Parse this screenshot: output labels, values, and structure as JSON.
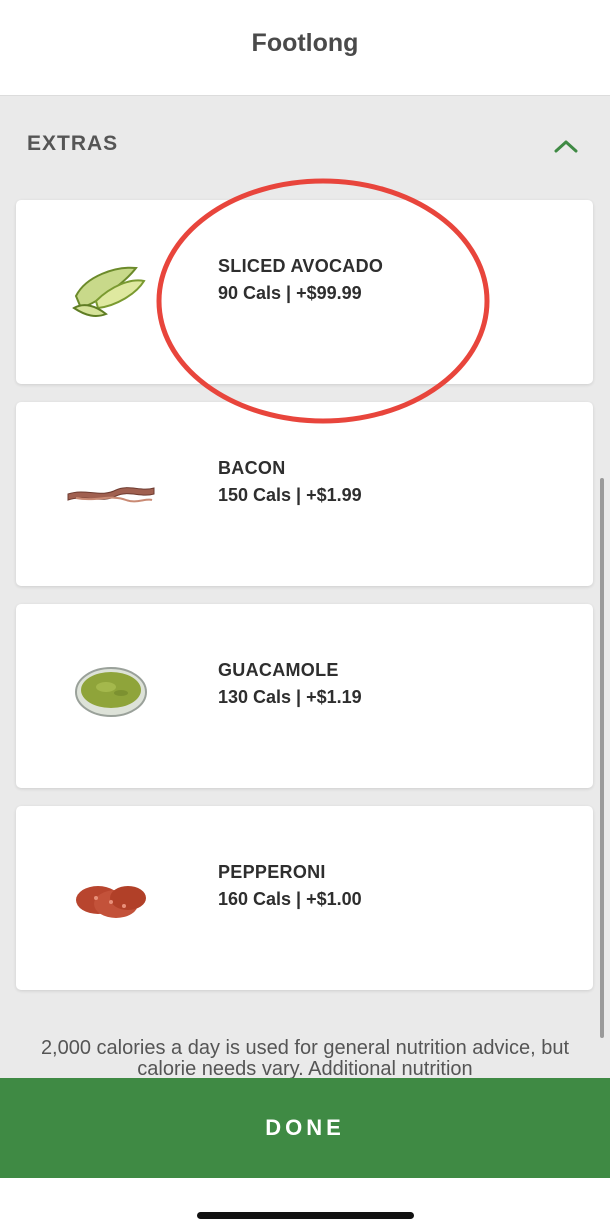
{
  "header": {
    "title": "Footlong"
  },
  "section": {
    "title": "EXTRAS",
    "expanded": true,
    "icon": "chevron-up-icon",
    "accent_color": "#3f8a44"
  },
  "items": [
    {
      "name": "SLICED AVOCADO",
      "info": "90 Cals | +$99.99",
      "image": "avocado-image"
    },
    {
      "name": "BACON",
      "info": "150 Cals | +$1.99",
      "image": "bacon-image"
    },
    {
      "name": "GUACAMOLE",
      "info": "130 Cals | +$1.19",
      "image": "guacamole-image"
    },
    {
      "name": "PEPPERONI",
      "info": "160 Cals | +$1.00",
      "image": "pepperoni-image"
    }
  ],
  "annotation": {
    "shape": "ellipse",
    "color": "#e8453c",
    "target": "SLICED AVOCADO"
  },
  "disclaimer": "2,000 calories a day is used for general nutrition advice, but calorie needs vary. Additional nutrition",
  "footer": {
    "done_label": "DONE",
    "color": "#3f8a44"
  }
}
